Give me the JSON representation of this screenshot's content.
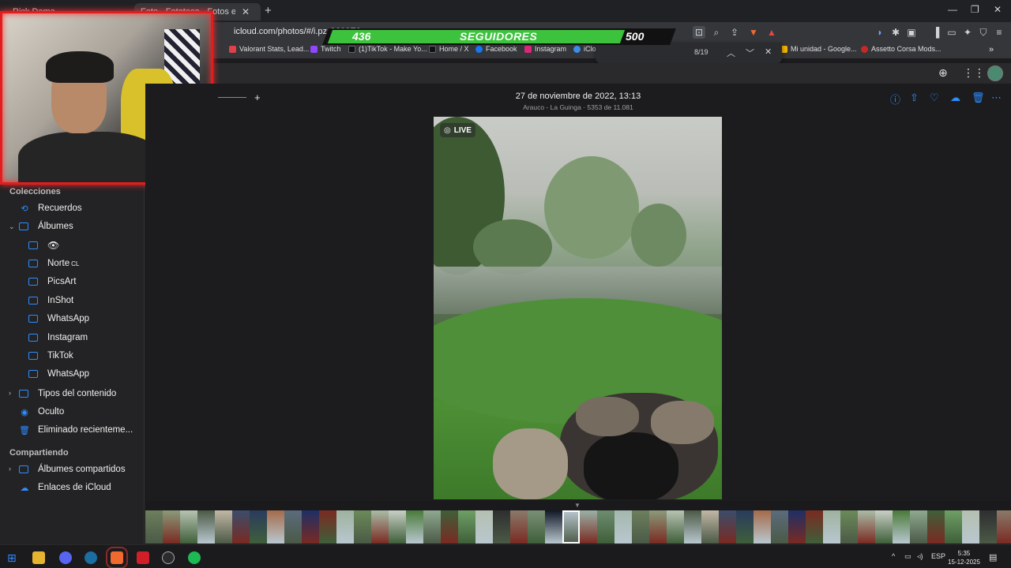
{
  "browser": {
    "tabs": [
      {
        "label": "Rick Dama... ",
        "active": false
      },
      {
        "label": "Foto - Fototeca - Fotos en iCloud",
        "active": true
      }
    ],
    "url": "icloud.com/photos/#/i.pz.C393E8",
    "find": {
      "count": "8/19"
    }
  },
  "bookmarks": [
    {
      "label": "Valorant Stats, Lead...",
      "color": "#e0404a"
    },
    {
      "label": "Twitch",
      "color": "#9146ff"
    },
    {
      "label": "(1)TikTok - Make Yo...",
      "color": "#111111"
    },
    {
      "label": "Home / X",
      "color": "#111111"
    },
    {
      "label": "Facebook",
      "color": "#1877f2"
    },
    {
      "label": "Instagram",
      "color": "#d62976"
    },
    {
      "label": "iCloud",
      "color": "#3b8ee8"
    },
    {
      "label": "Mi unidad - Google...",
      "color": "#f4b400"
    },
    {
      "label": "Assetto Corsa Mods...",
      "color": "#c62828"
    }
  ],
  "overlay": {
    "followers_current": "436",
    "followers_label": "SEGUIDORES",
    "followers_goal": "500"
  },
  "sidebar": {
    "collections_title": "Colecciones",
    "items": [
      {
        "label": "Recuerdos",
        "icon": "memories-icon"
      },
      {
        "label": "Álbumes",
        "icon": "albums-icon"
      }
    ],
    "albums": [
      {
        "label": ""
      },
      {
        "label": "Norte"
      },
      {
        "label": "PicsArt"
      },
      {
        "label": "InShot"
      },
      {
        "label": "WhatsApp"
      },
      {
        "label": "Instagram"
      },
      {
        "label": "TikTok"
      },
      {
        "label": "WhatsApp"
      }
    ],
    "more": [
      {
        "label": "Tipos del contenido"
      },
      {
        "label": "Oculto"
      },
      {
        "label": "Eliminado recienteme..."
      }
    ],
    "shared_title": "Compartiendo",
    "shared": [
      {
        "label": "Álbumes compartidos"
      },
      {
        "label": "Enlaces de iCloud"
      }
    ]
  },
  "viewer": {
    "date": "27 de noviembre de 2022, 13:13",
    "location": "Arauco - La Guinga · 5353 de 11.081",
    "live_badge": "LIVE"
  },
  "taskbar": {
    "lang": "ESP",
    "time": "5:35",
    "date": "15-12-2025"
  },
  "colors": {
    "accent": "#2d8cff",
    "overlay_green": "#3dc23d",
    "cam_border": "#e21d1d"
  }
}
